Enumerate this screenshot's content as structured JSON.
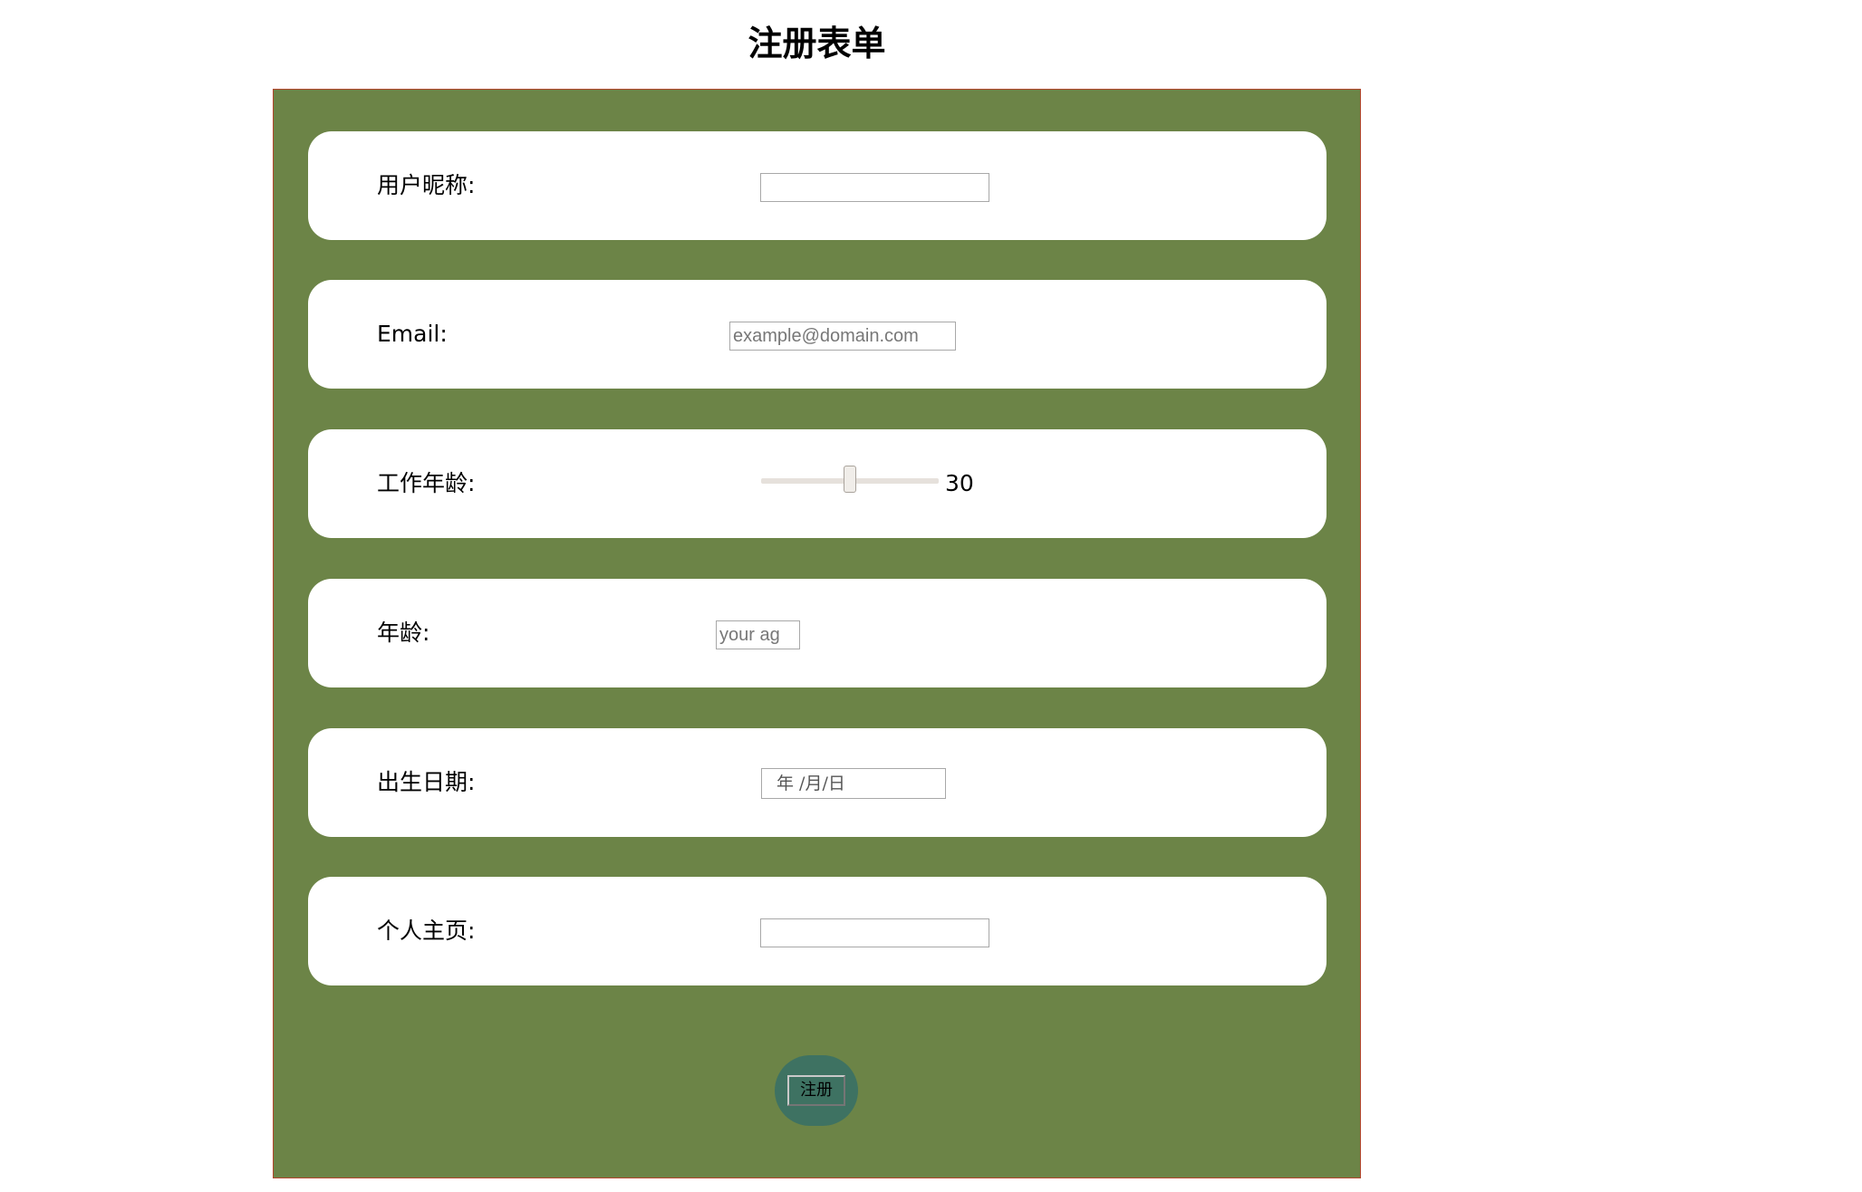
{
  "page": {
    "title": "注册表单"
  },
  "fields": {
    "nickname": {
      "label": "用户昵称:",
      "value": ""
    },
    "email": {
      "label": "Email:",
      "placeholder": "example@domain.com"
    },
    "work_age": {
      "label": "工作年龄:",
      "value_text": "30",
      "value": 30,
      "level_fraction": 0.5
    },
    "age": {
      "label": "年龄:",
      "placeholder": "your ag"
    },
    "birth_date": {
      "label": "出生日期:",
      "placeholder": "年 /月/日"
    },
    "homepage": {
      "label": "个人主页:",
      "value": ""
    }
  },
  "submit": {
    "label": "注册"
  },
  "colors": {
    "panel_background": "#6c8447",
    "panel_border": "#b5462e",
    "row_background": "#ffffff",
    "submit_background": "#3e7262"
  }
}
